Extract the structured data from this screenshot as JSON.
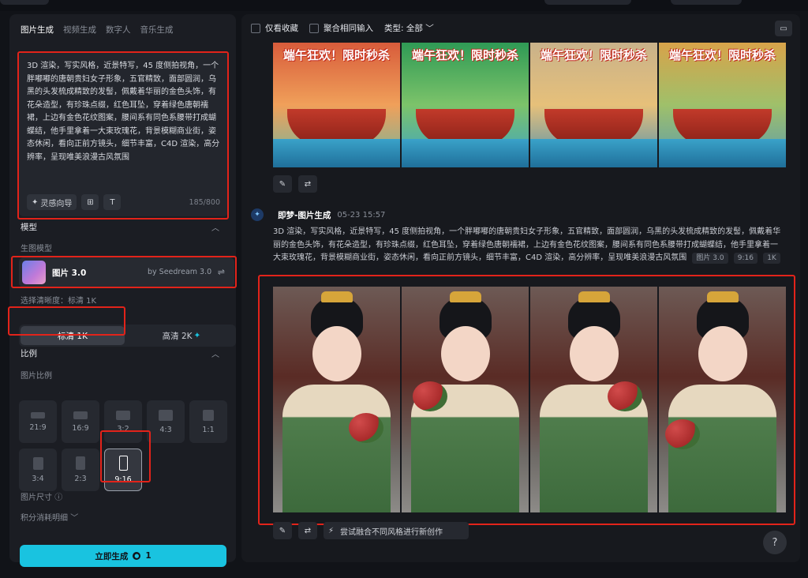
{
  "left_panel": {
    "tabs": [
      {
        "label": "图片生成",
        "active": true
      },
      {
        "label": "视频生成",
        "active": false
      },
      {
        "label": "数字人",
        "active": false
      },
      {
        "label": "音乐生成",
        "active": false
      }
    ],
    "prompt": {
      "text": "3D 渲染，写实风格，近景特写，45 度侧拍视角，一个胖嘟嘟的唐朝贵妇女子形象，五官精致，面部圆润，乌黑的头发梳成精致的发髻，佩戴着华丽的金色头饰，有花朵造型，有珍珠点缀，红色耳坠，穿着绿色唐朝襦裙，上边有金色花纹图案，腰间系有同色系腰带打成蝴蝶结，他手里拿着一大束玫瑰花，背景模糊商业街，姿态休闲，看向正前方镜头，细节丰富，C4D 渲染，高分辨率，呈现唯美浪漫古风氛围",
      "inspiration_label": "灵感向导",
      "counter": "185/800"
    },
    "model_section": {
      "title": "模型",
      "sub_label": "生图模型",
      "model_name": "图片 3.0",
      "model_by": "by Seedream 3.0"
    },
    "resolution": {
      "label": "选择清晰度：标清 1K",
      "options": [
        {
          "label": "标清 1K",
          "selected": true
        },
        {
          "label": "高清 2K",
          "selected": false
        }
      ]
    },
    "ratio_section": {
      "title": "比例",
      "sub_label": "图片比例",
      "ratios": [
        {
          "label": "21:9",
          "selected": false
        },
        {
          "label": "16:9",
          "selected": false
        },
        {
          "label": "3:2",
          "selected": false
        },
        {
          "label": "4:3",
          "selected": false
        },
        {
          "label": "1:1",
          "selected": false
        },
        {
          "label": "3:4",
          "selected": false
        },
        {
          "label": "2:3",
          "selected": false
        },
        {
          "label": "9:16",
          "selected": true
        }
      ]
    },
    "size_label": "图片尺寸",
    "credits_label": "积分消耗明细",
    "generate_button": {
      "label": "立即生成",
      "cost": "1"
    }
  },
  "right_panel": {
    "filters": {
      "favorites_label": "仅看收藏",
      "merge_label": "聚合相同输入",
      "type_label": "类型: 全部"
    },
    "posters": [
      {
        "headline": "端午狂欢！限时秒杀"
      },
      {
        "headline": "端午狂欢！限时秒杀"
      },
      {
        "headline": "端午狂欢！限时秒杀"
      },
      {
        "headline": "端午狂欢！限时秒杀"
      }
    ],
    "generation": {
      "title": "即梦-图片生成",
      "time": "05-23 15:57",
      "prompt": "3D 渲染，写实风格，近景特写，45 度侧拍视角，一个胖嘟嘟的唐朝贵妇女子形象，五官精致，面部圆润，乌黑的头发梳成精致的发髻，佩戴着华丽的金色头饰，有花朵造型，有珍珠点缀，红色耳坠，穿着绿色唐朝襦裙，上边有金色花纹图案，腰间系有同色系腰带打成蝴蝶结，他手里拿着一大束玫瑰花，背景模糊商业街，姿态休闲，看向正前方镜头，细节丰富，C4D 渲染，高分辨率，呈现唯美浪漫古风氛围",
      "tag_model": "图片 3.0",
      "tag_ratio": "9:16",
      "tag_res": "1K",
      "style_suggest": "尝试融合不同风格进行新创作"
    },
    "help_label": "?"
  }
}
